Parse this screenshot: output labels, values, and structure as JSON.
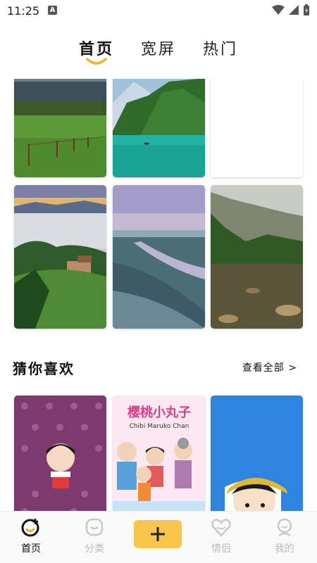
{
  "status_bar": {
    "time": "11:25",
    "notif_letter": "A"
  },
  "top_tabs": [
    {
      "label": "首页",
      "active": true
    },
    {
      "label": "宽屏",
      "active": false
    },
    {
      "label": "热门",
      "active": false
    }
  ],
  "wallpapers": [
    {
      "name": "meadow-fence"
    },
    {
      "name": "mountain-lake"
    },
    {
      "name": "blank"
    },
    {
      "name": "misty-hills-village"
    },
    {
      "name": "frosty-river-dusk"
    },
    {
      "name": "yosemite-cliff-river"
    }
  ],
  "section": {
    "title": "猜你喜欢",
    "view_all": "查看全部 >"
  },
  "recommend": [
    {
      "name": "chibi-maruko-pattern"
    },
    {
      "name": "chibi-maruko-family",
      "title_text": "樱桃小丸子",
      "subtitle_text": "Chibi Maruko Chan"
    },
    {
      "name": "maruko-blue"
    }
  ],
  "bottom_nav": [
    {
      "label": "首页",
      "icon": "home-smile-icon",
      "active": true
    },
    {
      "label": "分类",
      "icon": "category-icon",
      "active": false
    },
    {
      "label": "情侣",
      "icon": "couple-heart-icon",
      "active": false
    },
    {
      "label": "我的",
      "icon": "profile-icon",
      "active": false
    }
  ],
  "colors": {
    "accent": "#f7c64a",
    "active_text": "#111111",
    "inactive_text": "#bbbbbb"
  }
}
